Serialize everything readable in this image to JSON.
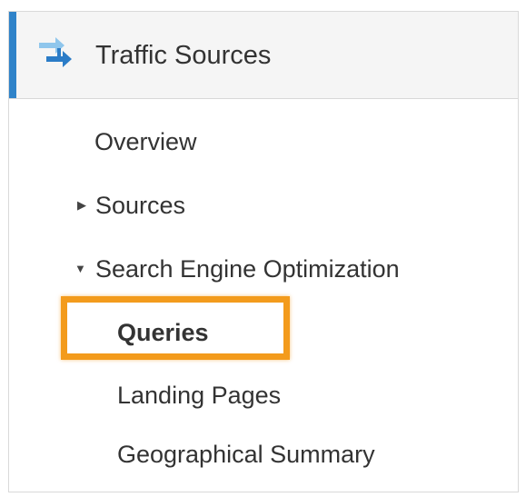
{
  "section": {
    "title": "Traffic Sources",
    "icon": "traffic-arrows-icon",
    "accent_color": "#2f83c9"
  },
  "nav": {
    "overview": "Overview",
    "sources": {
      "label": "Sources",
      "expanded": false,
      "caret_icon": "caret-right-icon"
    },
    "seo": {
      "label": "Search Engine Optimization",
      "expanded": true,
      "caret_icon": "caret-down-icon",
      "children": [
        {
          "label": "Queries",
          "selected": true
        },
        {
          "label": "Landing Pages",
          "selected": false
        },
        {
          "label": "Geographical Summary",
          "selected": false
        }
      ]
    }
  },
  "highlight_color": "#f39b1c"
}
